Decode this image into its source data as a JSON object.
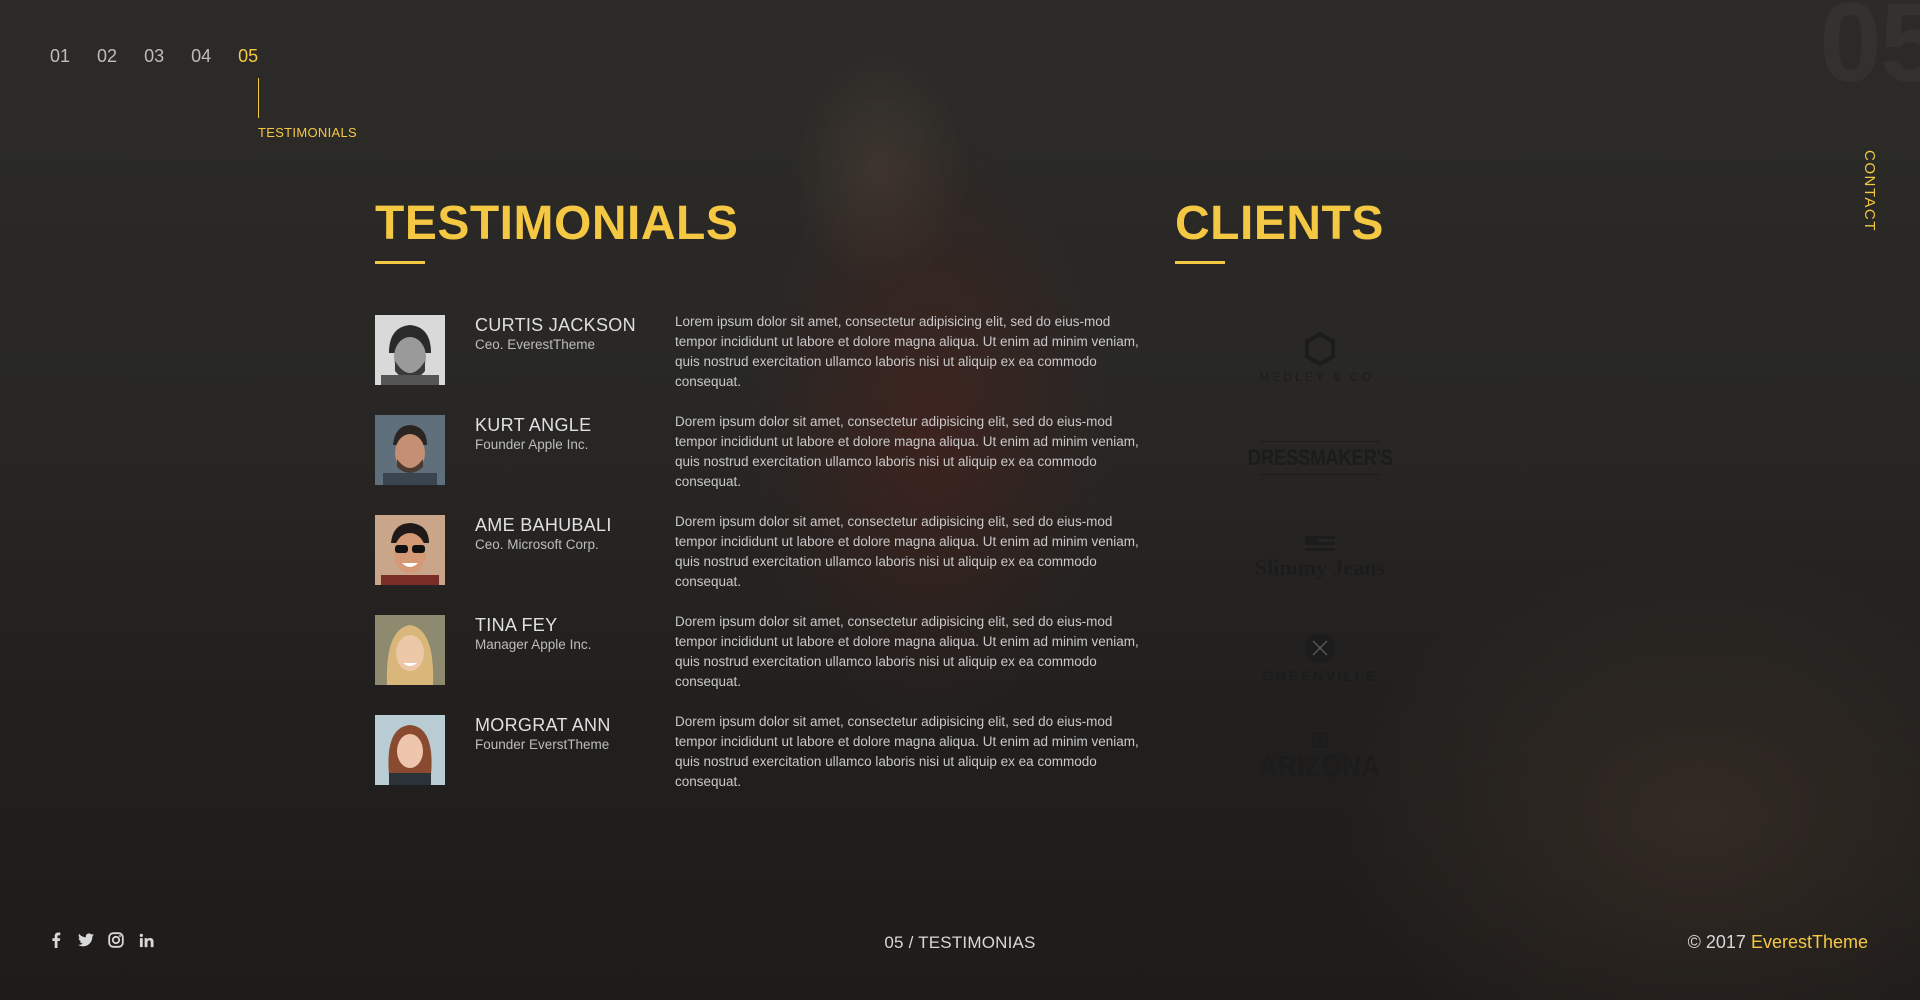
{
  "nav": {
    "items": [
      "01",
      "02",
      "03",
      "04",
      "05"
    ],
    "active": "05",
    "caption": "TESTIMONIALS"
  },
  "side_link": "CONTACT",
  "watermark": "05",
  "testimonials": {
    "title": "TESTIMONIALS",
    "items": [
      {
        "name": "CURTIS JACKSON",
        "role": "Ceo. EverestTheme",
        "quote": "Lorem ipsum dolor sit amet, consectetur adipisicing elit, sed do eius-mod tempor incididunt ut labore et dolore magna aliqua. Ut enim ad minim veniam, quis nostrud exercitation ullamco laboris nisi ut aliquip ex ea commodo consequat."
      },
      {
        "name": "KURT ANGLE",
        "role": "Founder Apple Inc.",
        "quote": "Dorem ipsum dolor sit amet, consectetur adipisicing elit, sed do eius-mod tempor incididunt ut labore et dolore magna aliqua. Ut enim ad minim veniam, quis nostrud exercitation ullamco laboris nisi ut aliquip ex ea commodo consequat."
      },
      {
        "name": "AME BAHUBALI",
        "role": "Ceo. Microsoft Corp.",
        "quote": "Dorem ipsum dolor sit amet, consectetur adipisicing elit, sed do eius-mod tempor incididunt ut labore et dolore magna aliqua. Ut enim ad minim veniam, quis nostrud exercitation ullamco laboris nisi ut aliquip ex ea commodo consequat."
      },
      {
        "name": "TINA FEY",
        "role": "Manager Apple Inc.",
        "quote": "Dorem ipsum dolor sit amet, consectetur adipisicing elit, sed do eius-mod tempor incididunt ut labore et dolore magna aliqua. Ut enim ad minim veniam, quis nostrud exercitation ullamco laboris nisi ut aliquip ex ea commodo consequat."
      },
      {
        "name": "MORGRAT ANN",
        "role": "Founder EverstTheme",
        "quote": "Dorem ipsum dolor sit amet, consectetur adipisicing elit, sed do eius-mod tempor incididunt ut labore et dolore magna aliqua. Ut enim ad minim veniam, quis nostrud exercitation ullamco laboris nisi ut aliquip ex ea commodo consequat."
      }
    ]
  },
  "clients": {
    "title": "CLIENTS",
    "logos": [
      {
        "name": "MEDLEY & CO.",
        "icon": "hexagon-icon"
      },
      {
        "name": "DRESSMAKER'S",
        "icon": "wordmark"
      },
      {
        "name": "Slimmy Jeans",
        "icon": "flag-icon"
      },
      {
        "name": "GREENVILLE",
        "icon": "circle-badge-icon"
      },
      {
        "name": "ARIZONA",
        "icon": "square-icon"
      }
    ]
  },
  "footer": {
    "social": [
      "facebook-icon",
      "twitter-icon",
      "instagram-icon",
      "linkedin-icon"
    ],
    "pager": "05 / TESTIMONIAS",
    "copyright": "© 2017",
    "brand": "EverestTheme"
  },
  "colors": {
    "accent": "#f5c843",
    "background": "#2e2c29"
  }
}
